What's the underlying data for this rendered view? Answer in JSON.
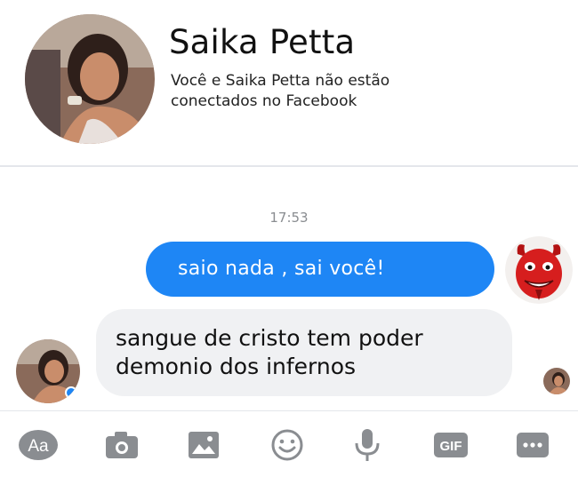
{
  "header": {
    "contact_name": "Saika Petta",
    "connection_status": "Você e Saika Petta não estão conectados no Facebook"
  },
  "conversation": {
    "timestamp": "17:53",
    "messages": [
      {
        "direction": "outgoing",
        "text": "saio nada , sai você!"
      },
      {
        "direction": "incoming",
        "lines": [
          "sangue de cristo tem poder",
          "demonio dos infernos"
        ]
      }
    ]
  },
  "toolbar": {
    "text_button_label": "Aa",
    "gif_button_label": "GIF",
    "icons": [
      "text-format-icon",
      "camera-icon",
      "image-icon",
      "emoji-icon",
      "microphone-icon",
      "gif-icon",
      "more-icon"
    ]
  },
  "colors": {
    "outgoing_bubble": "#1e86f5",
    "incoming_bubble": "#f0f1f3",
    "toolbar_icon": "#8a8d91",
    "timestamp": "#8a8d91"
  }
}
